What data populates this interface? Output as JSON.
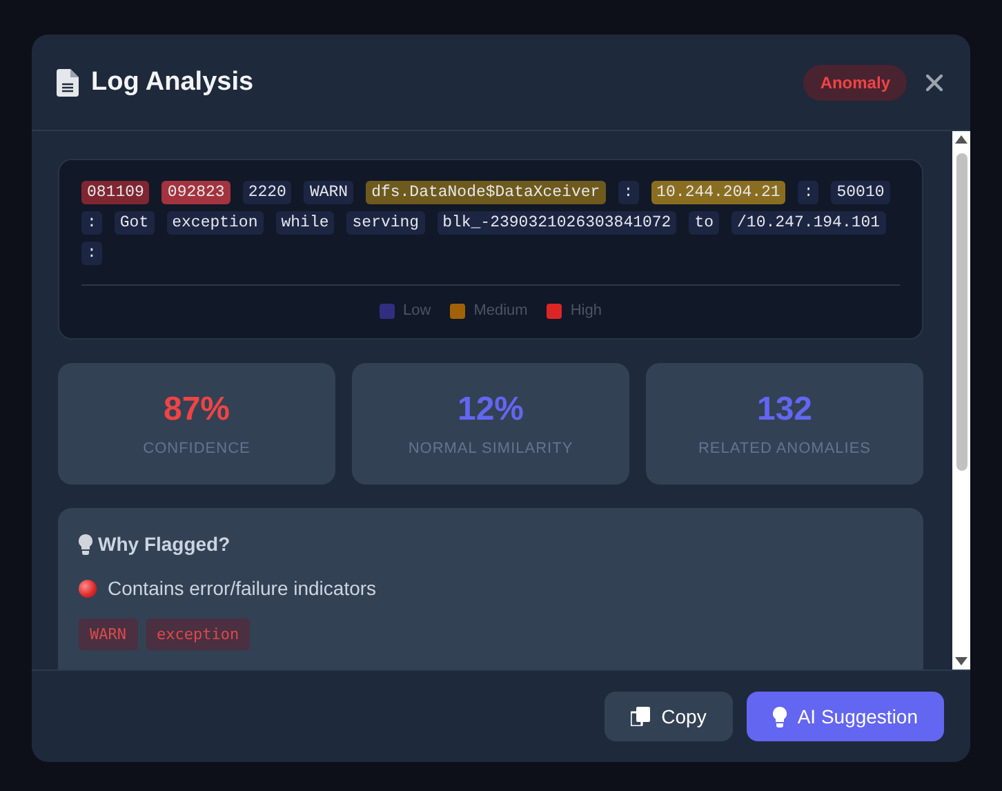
{
  "dialog": {
    "title": "Log Analysis",
    "badge": "Anomaly"
  },
  "log_tokens": [
    {
      "text": "081109",
      "color": "#7f2631"
    },
    {
      "text": "092823",
      "color": "#a3333e"
    },
    {
      "text": "2220",
      "color": "#1c2542"
    },
    {
      "text": "WARN",
      "color": "#1c2542"
    },
    {
      "text": "dfs.DataNode$DataXceiver",
      "color": "#6e5a1c"
    },
    {
      "text": ":",
      "color": "#1c2542"
    },
    {
      "text": "10.244.204.21",
      "color": "#8a6e1f"
    },
    {
      "text": ":",
      "color": "#1c2542"
    },
    {
      "text": "50010",
      "color": "#1c2542"
    },
    {
      "text": ":",
      "color": "#1c2542"
    },
    {
      "text": "Got",
      "color": "#1c2542"
    },
    {
      "text": "exception",
      "color": "#1c2542"
    },
    {
      "text": "while",
      "color": "#1c2542"
    },
    {
      "text": "serving",
      "color": "#1c2542"
    },
    {
      "text": "blk_-2390321026303841072",
      "color": "#1c2542"
    },
    {
      "text": "to",
      "color": "#1c2542"
    },
    {
      "text": "/10.247.194.101",
      "color": "#1c2542"
    },
    {
      "text": ":",
      "color": "#1c2542"
    }
  ],
  "legend": [
    {
      "label": "Low",
      "color": "#312e81"
    },
    {
      "label": "Medium",
      "color": "#a16207"
    },
    {
      "label": "High",
      "color": "#dc2626"
    }
  ],
  "stats": [
    {
      "value": "87%",
      "label": "CONFIDENCE",
      "color": "#ef4444"
    },
    {
      "value": "12%",
      "label": "NORMAL SIMILARITY",
      "color": "#6366f1"
    },
    {
      "value": "132",
      "label": "RELATED ANOMALIES",
      "color": "#6366f1"
    }
  ],
  "why_flagged": {
    "title": "Why Flagged?",
    "reasons": [
      {
        "text": "Contains error/failure indicators",
        "tags": [
          "WARN",
          "exception"
        ]
      }
    ]
  },
  "buttons": [
    {
      "label": "Copy",
      "kind": "secondary"
    },
    {
      "label": "AI Suggestion",
      "kind": "primary"
    }
  ]
}
